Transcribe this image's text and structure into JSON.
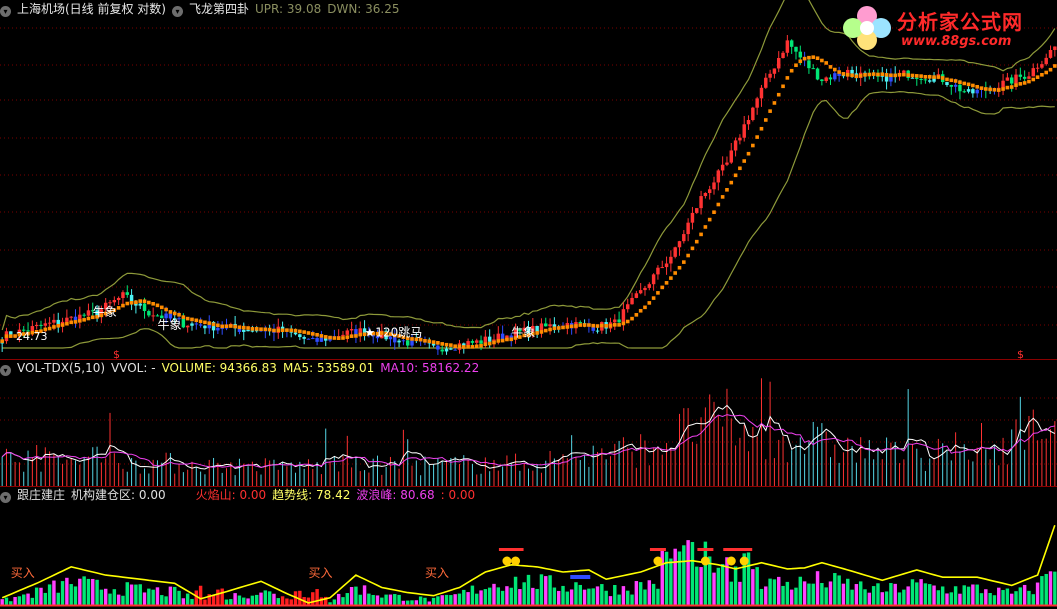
{
  "panels": {
    "main": {
      "title": "上海机场(日线 前复权 对数)",
      "indicator": "飞龙第四卦",
      "upr_label": "UPR: 39.08",
      "dwn_label": "DWN: 36.25",
      "low_mark": "24.73",
      "annotations": [
        {
          "text": "牛象",
          "idx": 21,
          "price": 25.7
        },
        {
          "text": "牛象",
          "idx": 36,
          "price": 25.0
        },
        {
          "text": "★120跳马",
          "idx": 84,
          "price": 24.6
        },
        {
          "text": "牛象",
          "idx": 118,
          "price": 24.6
        }
      ]
    },
    "vol": {
      "name": "VOL-TDX(5,10)",
      "vvol": "VVOL: -",
      "volume": "VOLUME: 94366.83",
      "ma5": "MA5: 53589.01",
      "ma10": "MA10: 58162.22"
    },
    "ind": {
      "name": "跟庄建庄",
      "jg": "机构建仓区: 0.00",
      "hys": "火焰山: 0.00",
      "qsx": "趋势线: 78.42",
      "blf": "波浪峰: 80.68",
      "extra": ": 0.00",
      "buy_label": "买入",
      "buy_positions": [
        2,
        71,
        98
      ]
    }
  },
  "logo": {
    "line1": "分析家公式网",
    "line2": "www.88gs.com"
  },
  "colors": {
    "up": "#ff3232",
    "down": "#00e676",
    "cyan": "#4cf2f2",
    "blue": "#2f4cff",
    "magenta": "#ff40ff",
    "orange": "#ff8c00",
    "yellow": "#ffff00",
    "olive": "#8e9a3a",
    "white": "#ffffff",
    "maroon": "#8a0000",
    "mapurple": "#ee40ee"
  },
  "chart_data": {
    "type": "candlestick",
    "bars": 245,
    "price_scale": "log",
    "price_range": [
      24.0,
      48.5
    ],
    "price_keypoints": [
      [
        0,
        24.6
      ],
      [
        10,
        25.2
      ],
      [
        22,
        25.9
      ],
      [
        28,
        26.8
      ],
      [
        34,
        25.9
      ],
      [
        42,
        25.3
      ],
      [
        55,
        25.0
      ],
      [
        65,
        24.9
      ],
      [
        72,
        24.3
      ],
      [
        78,
        24.7
      ],
      [
        84,
        24.9
      ],
      [
        92,
        24.4
      ],
      [
        100,
        24.0
      ],
      [
        110,
        24.3
      ],
      [
        120,
        24.8
      ],
      [
        130,
        25.3
      ],
      [
        138,
        25.1
      ],
      [
        142,
        25.3
      ],
      [
        148,
        27.0
      ],
      [
        156,
        29.5
      ],
      [
        162,
        33.0
      ],
      [
        168,
        35.5
      ],
      [
        174,
        40.0
      ],
      [
        178,
        43.0
      ],
      [
        182,
        46.0
      ],
      [
        186,
        44.0
      ],
      [
        190,
        42.5
      ],
      [
        196,
        43.2
      ],
      [
        202,
        42.5
      ],
      [
        210,
        43.0
      ],
      [
        218,
        42.5
      ],
      [
        224,
        41.2
      ],
      [
        230,
        41.8
      ],
      [
        238,
        43.0
      ],
      [
        244,
        45.5
      ]
    ],
    "volume_range": [
      0,
      160000
    ],
    "volume_keypoints": [
      [
        0,
        40000
      ],
      [
        30,
        35000
      ],
      [
        60,
        28000
      ],
      [
        90,
        30000
      ],
      [
        120,
        32000
      ],
      [
        150,
        55000
      ],
      [
        160,
        85000
      ],
      [
        168,
        95000
      ],
      [
        175,
        60000
      ],
      [
        185,
        70000
      ],
      [
        195,
        55000
      ],
      [
        210,
        45000
      ],
      [
        225,
        40000
      ],
      [
        244,
        94366.83
      ]
    ],
    "indicator_range": [
      0,
      100
    ],
    "trend_keypoints": [
      [
        0,
        8
      ],
      [
        8,
        22
      ],
      [
        16,
        38
      ],
      [
        24,
        30
      ],
      [
        32,
        26
      ],
      [
        40,
        22
      ],
      [
        46,
        7
      ],
      [
        52,
        14
      ],
      [
        60,
        24
      ],
      [
        66,
        12
      ],
      [
        71,
        3
      ],
      [
        76,
        8
      ],
      [
        82,
        30
      ],
      [
        88,
        18
      ],
      [
        94,
        13
      ],
      [
        100,
        10
      ],
      [
        106,
        18
      ],
      [
        112,
        33
      ],
      [
        118,
        40
      ],
      [
        124,
        38
      ],
      [
        130,
        33
      ],
      [
        136,
        35
      ],
      [
        140,
        26
      ],
      [
        148,
        33
      ],
      [
        154,
        42
      ],
      [
        160,
        44
      ],
      [
        166,
        40
      ],
      [
        170,
        36
      ],
      [
        176,
        42
      ],
      [
        182,
        36
      ],
      [
        186,
        37
      ],
      [
        190,
        42
      ],
      [
        196,
        35
      ],
      [
        204,
        25
      ],
      [
        212,
        35
      ],
      [
        218,
        28
      ],
      [
        226,
        28
      ],
      [
        234,
        20
      ],
      [
        240,
        30
      ],
      [
        244,
        78.42
      ]
    ],
    "legend": [
      "UPR: 39.08",
      "DWN: 36.25",
      "VOLUME: 94366.83",
      "MA5: 53589.01",
      "MA10: 58162.22",
      "趋势线: 78.42",
      "波浪峰: 80.68"
    ]
  }
}
